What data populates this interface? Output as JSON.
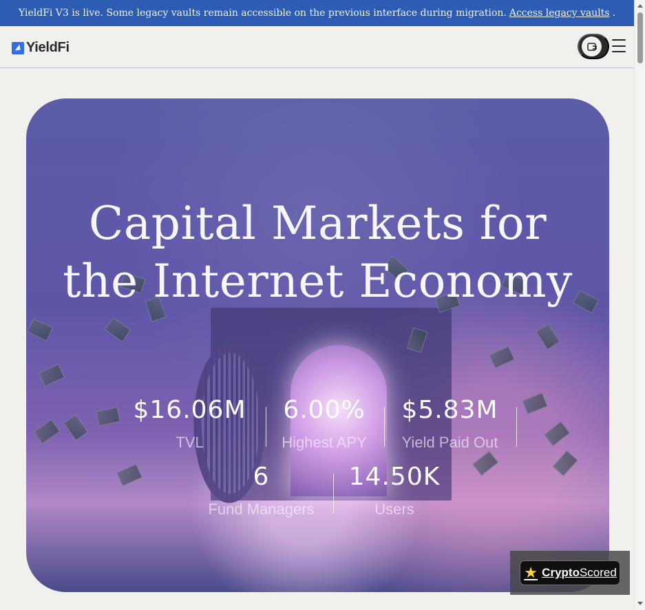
{
  "banner": {
    "message": "YieldFi V3 is live. Some legacy vaults remain accessible on the previous interface during migration.",
    "link": "Access legacy vaults"
  },
  "header": {
    "brand": "YieldFi",
    "wallet_icon": "wallet-icon",
    "menu_icon": "menu-icon"
  },
  "hero": {
    "title_line_1": "Capital Markets for",
    "title_line_2": "the Internet Economy"
  },
  "stats": [
    {
      "value": "$16.06M",
      "label": "TVL"
    },
    {
      "value": "6.00%",
      "label": "Highest APY"
    },
    {
      "value": "$5.83M",
      "label": "Yield Paid Out"
    },
    {
      "value": "6",
      "label": "Fund Managers"
    },
    {
      "value": "14.50K",
      "label": "Users"
    }
  ],
  "badge": {
    "icon": "star-icon",
    "brand_bold": "Crypto",
    "brand_regular": "Scored"
  },
  "colors": {
    "banner": "#2d5cb3",
    "page_background": "#f2f0ed",
    "hero_purple": "#5e55a7",
    "accent_blue": "#2f6fe6"
  }
}
